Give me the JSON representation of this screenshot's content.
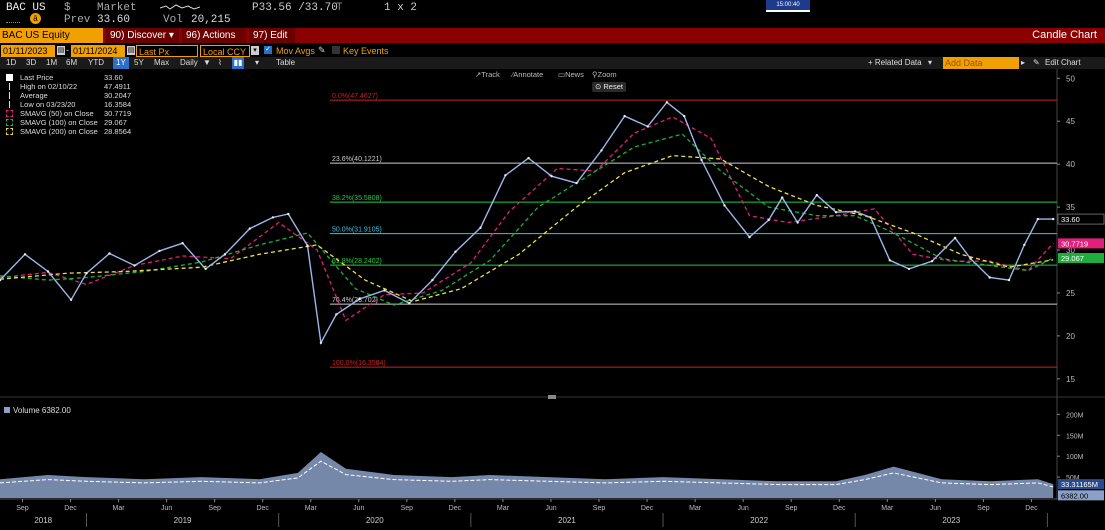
{
  "top": {
    "ticker": "BAC US",
    "currency_symbol": "$",
    "market_label": "Market",
    "price_range": "P33.56 /33.70",
    "range_suffix": "T",
    "size": "1 x 2",
    "prev_label": "Prev",
    "prev_value": "33.60",
    "vol_label": "Vol",
    "vol_value": "20,215",
    "clock": "15:00:40"
  },
  "toolbar": {
    "security": "BAC US Equity",
    "discover": "90) Discover",
    "actions": "96) Actions",
    "edit": "97) Edit",
    "chart_type": "Candle Chart"
  },
  "controls": {
    "start_date": "01/11/2023",
    "end_date": "01/11/2024",
    "price_field": "Last Px",
    "currency": "Local CCY",
    "mov_avgs_label": "Mov Avgs",
    "key_events_label": "Key Events"
  },
  "timeframes": [
    "1D",
    "3D",
    "1M",
    "6M",
    "YTD",
    "1Y",
    "5Y",
    "Max"
  ],
  "selected_timeframe": "1Y",
  "periodicity": "Daily",
  "table_label": "Table",
  "related_data_label": "+ Related Data",
  "add_data_placeholder": "Add Data",
  "edit_chart_label": "Edit Chart",
  "tools": {
    "track": "Track",
    "annotate": "Annotate",
    "news": "News",
    "zoom": "Zoom",
    "reset": "Reset"
  },
  "legend": [
    {
      "label": "Last Price",
      "value": "33.60",
      "color": "#ffffff",
      "style": "fill"
    },
    {
      "label": "High on 02/10/22",
      "value": "47.4911",
      "color": "#dddddd",
      "style": "marker"
    },
    {
      "label": "Average",
      "value": "30.2047",
      "color": "#dddddd",
      "style": "marker"
    },
    {
      "label": "Low on 03/23/20",
      "value": "16.3584",
      "color": "#dddddd",
      "style": "marker"
    },
    {
      "label": "SMAVG (50)  on Close",
      "value": "30.7719",
      "color": "#e0207a",
      "style": "dash"
    },
    {
      "label": "SMAVG (100)  on Close",
      "value": "29.067",
      "color": "#1fae3e",
      "style": "dash"
    },
    {
      "label": "SMAVG (200)  on Close",
      "value": "28.8564",
      "color": "#f0e04a",
      "style": "dash"
    }
  ],
  "volume_label": "Volume 6382.00",
  "colors": {
    "price": "#9bb8e8",
    "sma50": "#e0207a",
    "sma100": "#1fae3e",
    "sma200": "#f0e04a",
    "volume": "#8aa0c8",
    "fib_red": "#cc2222",
    "fib_white": "#cccccc",
    "fib_green": "#22cc44",
    "fib_cyan": "#39c6e6"
  },
  "chart_data": {
    "type": "line",
    "title": "Candle Chart",
    "y_axis": {
      "ticks": [
        15,
        20,
        25,
        30,
        35,
        40,
        45,
        50
      ],
      "range": [
        13,
        50.5
      ]
    },
    "volume_axis": {
      "ticks": [
        "50M",
        "100M",
        "150M",
        "200M"
      ],
      "range": [
        0,
        220
      ]
    },
    "x_axis": {
      "months": [
        "Sep",
        "Dec",
        "Mar",
        "Jun",
        "Sep",
        "Dec",
        "Mar",
        "Jun",
        "Sep",
        "Dec",
        "Mar",
        "Jun",
        "Sep",
        "Dec",
        "Mar",
        "Jun",
        "Sep",
        "Dec",
        "Mar",
        "Jun",
        "Sep",
        "Dec"
      ],
      "years": [
        "2018",
        "2019",
        "2020",
        "2021",
        "2022",
        "2023"
      ],
      "range": [
        2018.55,
        2024.05
      ]
    },
    "price_labels": [
      {
        "text": "33.60",
        "value": 33.6,
        "bg": "#000000",
        "fg": "#ffffff"
      },
      {
        "text": "30.7719",
        "value": 30.7719,
        "bg": "#e0207a",
        "fg": "#ffffff"
      },
      {
        "text": "29.067",
        "value": 29.067,
        "bg": "#1fae3e",
        "fg": "#ffffff"
      }
    ],
    "volume_labels": [
      {
        "text": "33.31165M",
        "value": 33.3,
        "bg": "#2a4a8a",
        "fg": "#ffffff"
      },
      {
        "text": "6382.00",
        "value": 6.4,
        "bg": "#8aa0c8",
        "fg": "#000000"
      }
    ],
    "fib_levels": [
      {
        "label": "0.0%(47.4627)",
        "value": 47.4627,
        "color": "fib_red"
      },
      {
        "label": "23.6%(40.1221)",
        "value": 40.1221,
        "color": "fib_white"
      },
      {
        "label": "38.2%(35.5808)",
        "value": 35.5808,
        "color": "fib_green"
      },
      {
        "label": "50.0%(31.9105)",
        "value": 31.9105,
        "color": "fib_cyan"
      },
      {
        "label": "61.8%(28.2402)",
        "value": 28.2402,
        "color": "fib_green"
      },
      {
        "label": "76.4%(23.702)",
        "value": 23.702,
        "color": "fib_white"
      },
      {
        "label": "100.0%(16.3584)",
        "value": 16.3584,
        "color": "fib_red"
      }
    ],
    "series": [
      {
        "name": "Last Price",
        "x": [
          2018.55,
          2018.68,
          2018.8,
          2018.92,
          2019.0,
          2019.12,
          2019.25,
          2019.38,
          2019.5,
          2019.62,
          2019.72,
          2019.85,
          2019.97,
          2020.05,
          2020.15,
          2020.22,
          2020.3,
          2020.42,
          2020.55,
          2020.68,
          2020.8,
          2020.92,
          2021.05,
          2021.18,
          2021.3,
          2021.42,
          2021.55,
          2021.68,
          2021.8,
          2021.92,
          2022.02,
          2022.11,
          2022.2,
          2022.32,
          2022.45,
          2022.55,
          2022.62,
          2022.7,
          2022.8,
          2022.9,
          2023.0,
          2023.08,
          2023.18,
          2023.28,
          2023.4,
          2023.52,
          2023.6,
          2023.7,
          2023.8,
          2023.88,
          2023.95,
          2024.03
        ],
        "values": [
          26.5,
          29.5,
          27.5,
          24.2,
          27.3,
          29.6,
          28.2,
          29.9,
          30.8,
          27.8,
          29.5,
          32.5,
          33.8,
          34.2,
          30.5,
          19.2,
          22.5,
          24.3,
          25.3,
          23.8,
          26.5,
          29.8,
          32.6,
          38.7,
          40.7,
          38.6,
          37.8,
          41.6,
          45.6,
          44.4,
          47.2,
          45.6,
          40.5,
          35.2,
          31.5,
          33.5,
          36.1,
          33.2,
          36.4,
          34.4,
          34.5,
          33.8,
          28.8,
          27.8,
          28.7,
          31.4,
          29.0,
          26.8,
          26.5,
          30.6,
          33.6,
          33.6
        ]
      },
      {
        "name": "SMAVG (50)  on Close",
        "x": [
          2018.55,
          2018.8,
          2019.0,
          2019.25,
          2019.5,
          2019.75,
          2020.0,
          2020.2,
          2020.35,
          2020.55,
          2020.75,
          2021.0,
          2021.2,
          2021.45,
          2021.65,
          2021.85,
          2022.05,
          2022.25,
          2022.45,
          2022.65,
          2022.9,
          2023.1,
          2023.3,
          2023.5,
          2023.7,
          2023.9,
          2024.03
        ],
        "values": [
          26.8,
          27.4,
          26.0,
          28.2,
          29.3,
          29.0,
          33.2,
          30.0,
          21.8,
          24.8,
          25.0,
          28.5,
          34.5,
          39.5,
          39.2,
          43.6,
          45.5,
          43.0,
          34.0,
          33.2,
          34.0,
          34.8,
          29.5,
          28.7,
          28.7,
          27.6,
          30.8
        ]
      },
      {
        "name": "SMAVG (100)  on Close",
        "x": [
          2018.55,
          2018.8,
          2019.0,
          2019.3,
          2019.6,
          2019.9,
          2020.15,
          2020.4,
          2020.6,
          2020.85,
          2021.1,
          2021.35,
          2021.6,
          2021.85,
          2022.1,
          2022.3,
          2022.55,
          2022.8,
          2023.0,
          2023.2,
          2023.45,
          2023.7,
          2023.9,
          2024.03
        ],
        "values": [
          27.0,
          26.5,
          26.8,
          27.5,
          28.6,
          30.6,
          32.0,
          25.5,
          23.6,
          25.3,
          28.8,
          35.0,
          38.5,
          42.0,
          43.5,
          39.2,
          35.0,
          34.0,
          34.0,
          32.0,
          29.0,
          28.2,
          27.6,
          29.07
        ]
      },
      {
        "name": "SMAVG (200)  on Close",
        "x": [
          2018.55,
          2018.9,
          2019.2,
          2019.6,
          2019.9,
          2020.2,
          2020.45,
          2020.7,
          2020.95,
          2021.25,
          2021.55,
          2021.8,
          2022.05,
          2022.3,
          2022.55,
          2022.8,
          2023.05,
          2023.3,
          2023.55,
          2023.8,
          2024.03
        ],
        "values": [
          26.6,
          27.3,
          27.5,
          28.0,
          29.5,
          30.6,
          26.5,
          24.0,
          25.5,
          29.5,
          35.0,
          39.0,
          41.0,
          40.6,
          37.4,
          35.2,
          34.0,
          32.0,
          29.5,
          28.0,
          28.86
        ]
      },
      {
        "name": "Volume 6382.00",
        "x": [
          2018.55,
          2018.8,
          2019.0,
          2019.3,
          2019.6,
          2019.9,
          2020.1,
          2020.22,
          2020.35,
          2020.6,
          2020.9,
          2021.1,
          2021.4,
          2021.7,
          2022.0,
          2022.3,
          2022.6,
          2022.9,
          2023.05,
          2023.2,
          2023.45,
          2023.7,
          2023.95,
          2024.03
        ],
        "values": [
          45,
          55,
          50,
          45,
          50,
          45,
          60,
          110,
          70,
          55,
          50,
          55,
          50,
          45,
          50,
          45,
          40,
          40,
          55,
          75,
          45,
          40,
          45,
          33.3
        ]
      }
    ]
  }
}
